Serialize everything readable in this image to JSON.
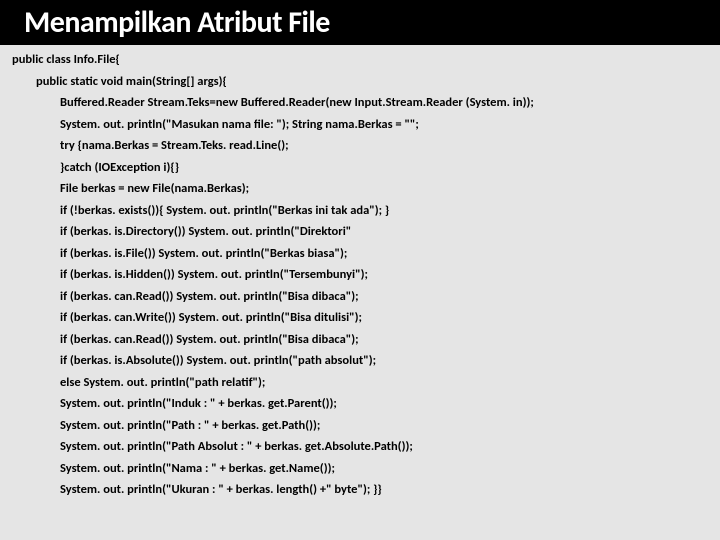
{
  "title": "Menampilkan Atribut File",
  "code": {
    "l0": "public class Info.File{",
    "l1": "public static void main(String[] args){",
    "l2": "Buffered.Reader Stream.Teks=new Buffered.Reader(new Input.Stream.Reader (System. in));",
    "l3": "System. out. println(\"Masukan nama file: \"); String nama.Berkas = \"\";",
    "l4": "try {nama.Berkas = Stream.Teks. read.Line();",
    "l5": "}catch (IOException i){}",
    "l6": "File berkas = new File(nama.Berkas);",
    "l7": "if (!berkas. exists()){ System. out. println(\"Berkas ini tak ada\"); }",
    "l8": "if (berkas. is.Directory()) System. out. println(\"Direktori\"",
    "l9": "if (berkas. is.File()) System. out. println(\"Berkas biasa\");",
    "l10": "if (berkas. is.Hidden()) System. out. println(\"Tersembunyi\");",
    "l11": "if (berkas. can.Read()) System. out. println(\"Bisa dibaca\");",
    "l12": "if (berkas. can.Write()) System. out. println(\"Bisa ditulisi\");",
    "l13": "if (berkas. can.Read()) System. out. println(\"Bisa dibaca\");",
    "l14": "if (berkas. is.Absolute()) System. out. println(\"path absolut\");",
    "l15": "else System. out. println(\"path relatif\");",
    "l16": "System. out. println(\"Induk : \" + berkas. get.Parent());",
    "l17": "System. out. println(\"Path : \" + berkas. get.Path());",
    "l18": "System. out. println(\"Path Absolut : \" + berkas. get.Absolute.Path());",
    "l19": "System. out. println(\"Nama : \" + berkas. get.Name());",
    "l20": "System. out. println(\"Ukuran : \" + berkas. length() +\" byte\"); }}"
  }
}
